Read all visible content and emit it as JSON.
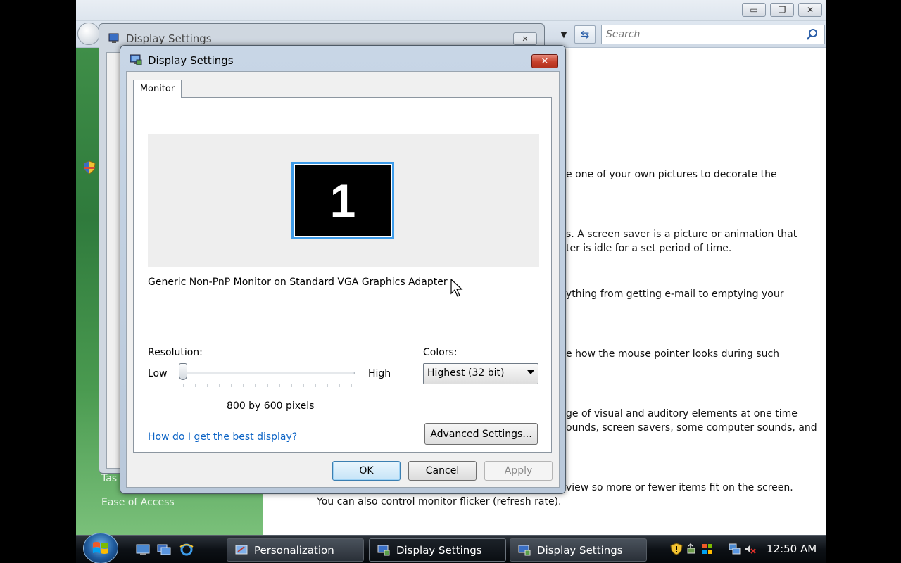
{
  "explorer": {
    "search_placeholder": "Search",
    "sidebar_links": [
      "Tas",
      "Ease of Access"
    ],
    "descriptions": [
      "e one of your own pictures to decorate the",
      "s. A screen saver is a picture or animation that",
      "ter is idle for a set period of time.",
      "ything from getting e-mail to emptying your",
      "e how the mouse pointer looks during such",
      "ge of visual and auditory elements at one time",
      "ounds, screen savers, some computer sounds, and",
      "view so more or fewer items fit on the screen.",
      "You can also control monitor flicker (refresh rate)."
    ]
  },
  "ghost_dialog": {
    "title": "Display Settings"
  },
  "dialog": {
    "title": "Display Settings",
    "tab": "Monitor",
    "monitor_number": "1",
    "monitor_name": "Generic Non-PnP Monitor on Standard VGA Graphics Adapter",
    "resolution_label": "Resolution:",
    "low_label": "Low",
    "high_label": "High",
    "resolution_value": "800 by 600 pixels",
    "resolution_level": 0,
    "colors_label": "Colors:",
    "colors_value": "Highest (32 bit)",
    "help_link": "How do I get the best display?",
    "advanced_button": "Advanced Settings...",
    "ok_button": "OK",
    "cancel_button": "Cancel",
    "apply_button": "Apply"
  },
  "taskbar": {
    "tasks": [
      "Personalization",
      "Display Settings",
      "Display Settings"
    ],
    "clock": "12:50 AM"
  },
  "colors": {
    "accent_blue": "#3d9be9",
    "link_blue": "#0b63c5",
    "close_red": "#c6402b",
    "sidebar_green": "#2f7a3c"
  }
}
